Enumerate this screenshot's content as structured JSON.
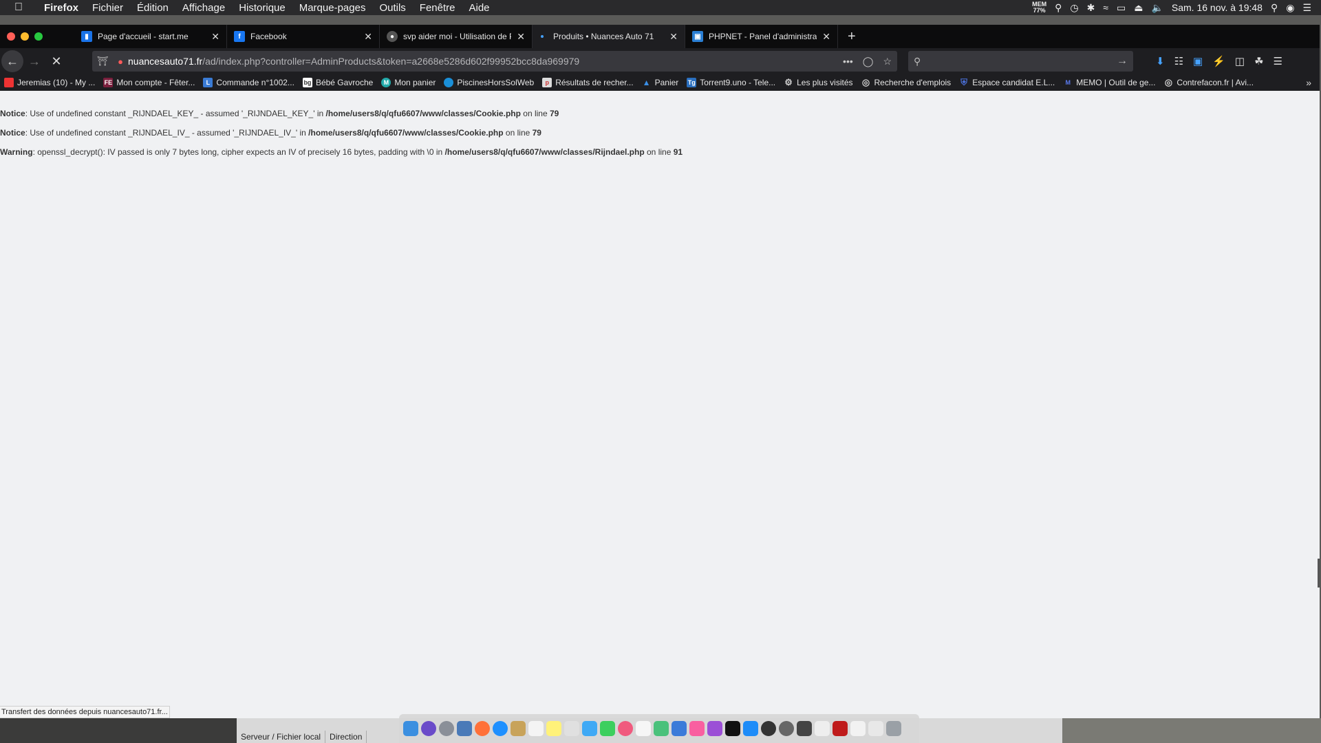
{
  "menubar": {
    "apple": "",
    "app_name": "Firefox",
    "items": [
      "Fichier",
      "Édition",
      "Affichage",
      "Historique",
      "Marque-pages",
      "Outils",
      "Fenêtre",
      "Aide"
    ],
    "mem_label": "MEM",
    "mem_value": "77%",
    "datetime": "Sam. 16 nov. à 19:48"
  },
  "tabs": [
    {
      "title": "Page d'accueil - start.me",
      "favicon": "start-me-icon",
      "color": "#1a73e8"
    },
    {
      "title": "Facebook",
      "favicon": "facebook-icon",
      "color": "#1877f2"
    },
    {
      "title": "svp aider moi - Utilisation de Pr",
      "favicon": "forum-icon",
      "color": "#cfcfcf"
    },
    {
      "title": "Produits • Nuances Auto 71",
      "favicon": "loading-dot",
      "color": "#45a1ff"
    },
    {
      "title": "PHPNET - Panel d'administratio",
      "favicon": "phpnet-icon",
      "color": "#2a7fd4"
    }
  ],
  "active_tab_index": 3,
  "urlbar": {
    "host": "nuancesauto71.fr",
    "path": "/ad/index.php?controller=AdminProducts&token=a2668e5286d602f99952bcc8da969979"
  },
  "bookmarks": [
    {
      "label": "Jeremias (10) - My ...",
      "icon": "fire-icon",
      "color": "#e33"
    },
    {
      "label": "Mon compte - Fêter...",
      "icon": "fe-icon",
      "color": "#7a1f3d"
    },
    {
      "label": "Commande n°1002...",
      "icon": "l-icon",
      "color": "#3a7bd5"
    },
    {
      "label": "Bébé Gavroche",
      "icon": "bg-icon",
      "color": "#ffffff"
    },
    {
      "label": "Mon panier",
      "icon": "m-icon",
      "color": "#22aaaa"
    },
    {
      "label": "PiscinesHorsSolWeb",
      "icon": "wave-icon",
      "color": "#1a8fd8"
    },
    {
      "label": "Résultats de recher...",
      "icon": "page-icon",
      "color": "#dddddd"
    },
    {
      "label": "Panier",
      "icon": "triangle-icon",
      "color": "#3a8ee6"
    },
    {
      "label": "Torrent9.uno - Tele...",
      "icon": "t9-icon",
      "color": "#2a6fbf"
    },
    {
      "label": "Les plus visités",
      "icon": "gear-icon",
      "color": "#cccccc"
    },
    {
      "label": "Recherche d'emplois",
      "icon": "globe-icon",
      "color": "#cccccc"
    },
    {
      "label": "Espace candidat E.L...",
      "icon": "shield-icon",
      "color": "#4a6fd8"
    },
    {
      "label": "MEMO | Outil de ge...",
      "icon": "m-icon",
      "color": "#3b5bdb"
    },
    {
      "label": "Contrefacon.fr | Avi...",
      "icon": "globe-icon",
      "color": "#cccccc"
    }
  ],
  "messages": [
    {
      "level": "Notice",
      "text": ": Use of undefined constant _RIJNDAEL_KEY_ - assumed '_RIJNDAEL_KEY_' in ",
      "file": "/home/users8/q/qfu6607/www/classes/Cookie.php",
      "on_line": " on line ",
      "line": "79"
    },
    {
      "level": "Notice",
      "text": ": Use of undefined constant _RIJNDAEL_IV_ - assumed '_RIJNDAEL_IV_' in ",
      "file": "/home/users8/q/qfu6607/www/classes/Cookie.php",
      "on_line": " on line ",
      "line": "79"
    },
    {
      "level": "Warning",
      "text": ": openssl_decrypt(): IV passed is only 7 bytes long, cipher expects an IV of precisely 16 bytes, padding with \\0 in ",
      "file": "/home/users8/q/qfu6607/www/classes/Rijndael.php",
      "on_line": " on line ",
      "line": "91"
    }
  ],
  "status_text": "Transfert des données depuis nuancesauto71.fr...",
  "filezilla": {
    "server_label": "Serveur / Fichier local",
    "direction_label": "Direction"
  },
  "colors": {
    "page_bg": "#f0f1f3",
    "chrome_dark": "#1e1e21",
    "tab_bar": "#0c0c0d",
    "accent": "#45a1ff"
  }
}
